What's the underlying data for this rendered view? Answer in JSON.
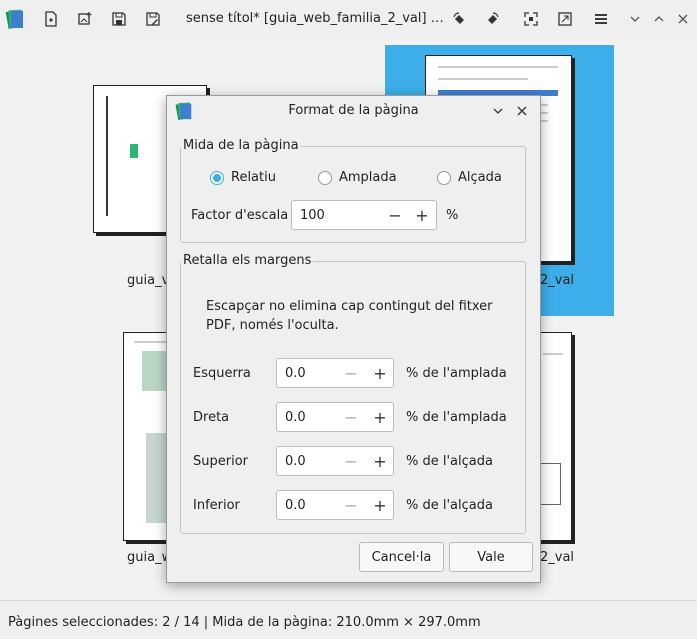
{
  "window": {
    "title": "sense títol* [guia_web_familia_2_val] …",
    "toolbar_icons": [
      "app-icon",
      "new-document-icon",
      "add-image-icon",
      "save-icon",
      "save-as-icon",
      "rotate-left-icon",
      "rotate-right-icon",
      "fullscreen-icon",
      "fit-icon",
      "menu-icon",
      "chevron-down-icon",
      "chevron-up-icon",
      "close-icon"
    ]
  },
  "thumbnails": [
    {
      "label": "guia_v"
    },
    {
      "label": "2_val",
      "selected": true
    },
    {
      "label": "guia_w"
    },
    {
      "label": "2_val"
    }
  ],
  "dialog": {
    "title": "Format de la pàgina",
    "page_size_group": {
      "title": "Mida de la pàgina",
      "radios": [
        {
          "label": "Relatiu",
          "checked": true
        },
        {
          "label": "Amplada",
          "checked": false
        },
        {
          "label": "Alçada",
          "checked": false
        }
      ],
      "scale_label": "Factor d'escala",
      "scale_value": "100",
      "scale_unit": "%"
    },
    "margins_group": {
      "title": "Retalla els margens",
      "note": "Escapçar no elimina cap contingut del fitxer PDF, només l'oculta.",
      "rows": [
        {
          "label": "Esquerra",
          "value": "0.0",
          "unit": "% de l'amplada"
        },
        {
          "label": "Dreta",
          "value": "0.0",
          "unit": "% de l'amplada"
        },
        {
          "label": "Superior",
          "value": "0.0",
          "unit": "% de l'alçada"
        },
        {
          "label": "Inferior",
          "value": "0.0",
          "unit": "% de l'alçada"
        }
      ]
    },
    "buttons": {
      "cancel": "Cancel·la",
      "ok": "Vale"
    }
  },
  "status": {
    "text": "Pàgines seleccionades: 2 / 14 | Mida de la pàgina: 210.0mm × 297.0mm"
  },
  "colors": {
    "accent": "#3daee9"
  }
}
